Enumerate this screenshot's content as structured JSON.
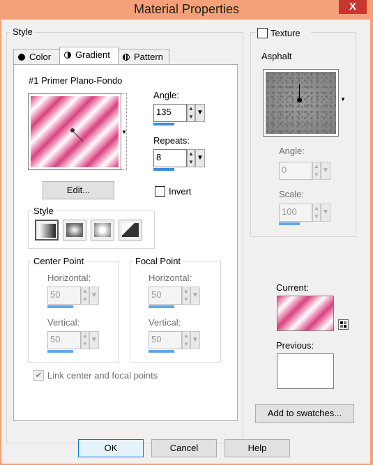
{
  "window": {
    "title": "Material Properties",
    "close_glyph": "X"
  },
  "style_group": {
    "label": "Style",
    "tabs": [
      {
        "label": "Color",
        "icon": "filled-circle-icon"
      },
      {
        "label": "Gradient",
        "icon": "half-circle-icon",
        "active": true
      },
      {
        "label": "Pattern",
        "icon": "pattern-icon"
      }
    ],
    "gradient_name": "#1 Primer Plano-Fondo",
    "edit_button": "Edit...",
    "angle": {
      "label": "Angle:",
      "value": "135"
    },
    "repeats": {
      "label": "Repeats:",
      "value": "8"
    },
    "invert": {
      "label": "Invert",
      "checked": false
    },
    "style_box": {
      "label": "Style",
      "options": [
        "linear",
        "rectangular",
        "sunburst",
        "radial"
      ],
      "selected": "linear"
    },
    "center_point": {
      "label": "Center Point",
      "horizontal": {
        "label": "Horizontal:",
        "value": "50"
      },
      "vertical": {
        "label": "Vertical:",
        "value": "50"
      }
    },
    "focal_point": {
      "label": "Focal Point",
      "horizontal": {
        "label": "Horizontal:",
        "value": "50"
      },
      "vertical": {
        "label": "Vertical:",
        "value": "50"
      }
    },
    "link_points": {
      "label": "Link center and focal points",
      "checked": true
    }
  },
  "texture_group": {
    "label": "Texture",
    "checked": false,
    "texture_name": "Asphalt",
    "angle": {
      "label": "Angle:",
      "value": "0"
    },
    "scale": {
      "label": "Scale:",
      "value": "100"
    }
  },
  "current": {
    "label": "Current:"
  },
  "previous": {
    "label": "Previous:"
  },
  "add_to_swatches": "Add to swatches...",
  "buttons": {
    "ok": "OK",
    "cancel": "Cancel",
    "help": "Help"
  },
  "colors": {
    "accent_pink": "#d8427e",
    "light_pink": "#f4b2cd",
    "titlebar": "#f5a078",
    "focus_blue": "#0078d7"
  }
}
